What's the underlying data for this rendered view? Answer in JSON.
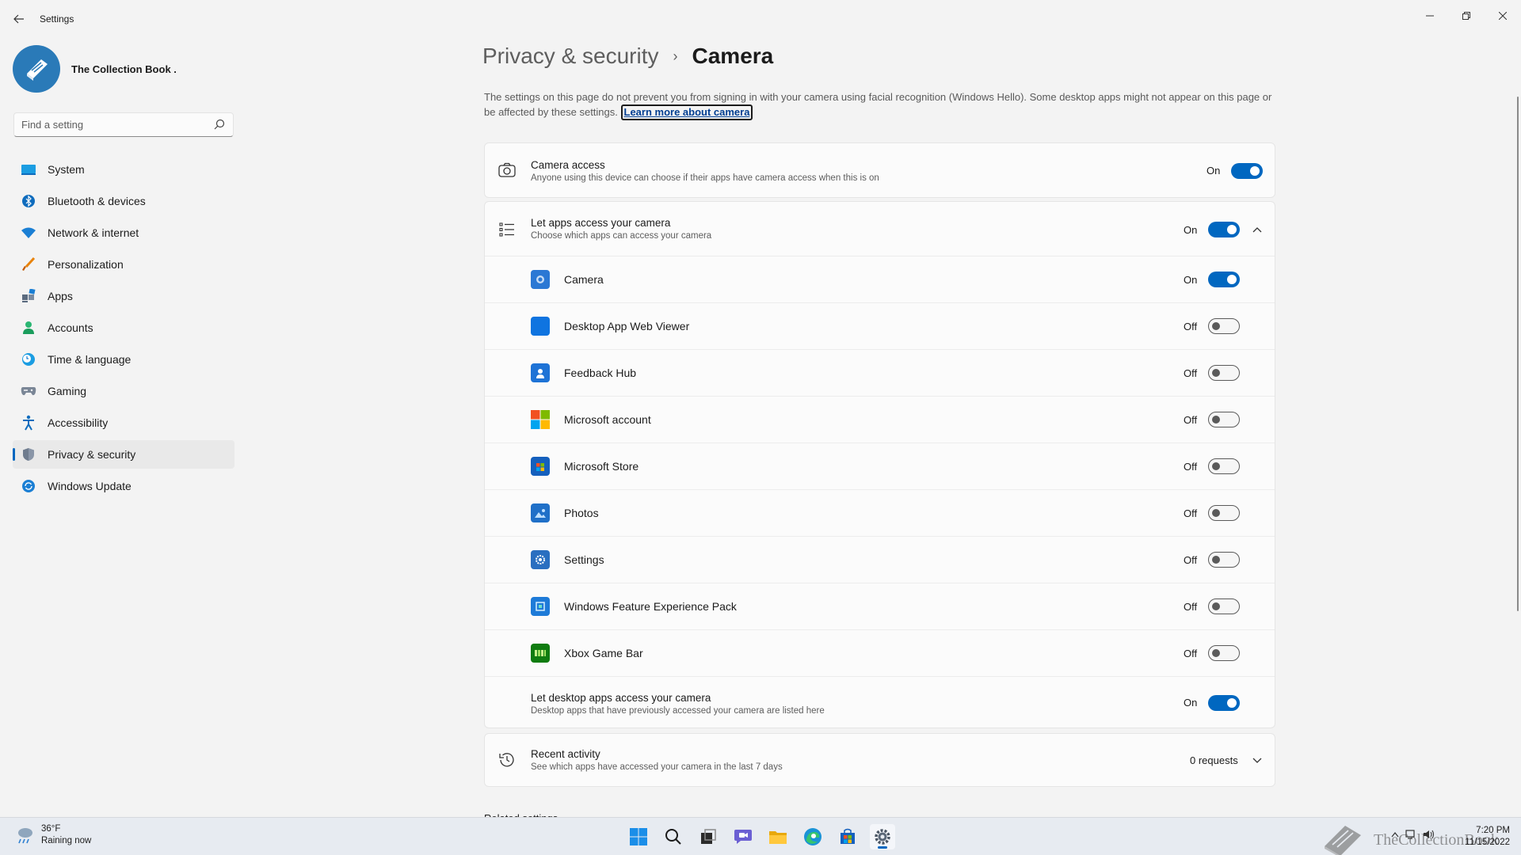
{
  "window": {
    "title": "Settings",
    "controls": [
      "minimize",
      "restore",
      "close"
    ]
  },
  "profile": {
    "name": "The Collection Book ."
  },
  "search": {
    "placeholder": "Find a setting"
  },
  "sidebar": {
    "items": [
      {
        "label": "System",
        "icon": "system-icon"
      },
      {
        "label": "Bluetooth & devices",
        "icon": "bluetooth-icon"
      },
      {
        "label": "Network & internet",
        "icon": "wifi-icon"
      },
      {
        "label": "Personalization",
        "icon": "brush-icon"
      },
      {
        "label": "Apps",
        "icon": "apps-icon"
      },
      {
        "label": "Accounts",
        "icon": "accounts-icon"
      },
      {
        "label": "Time & language",
        "icon": "clock-globe-icon"
      },
      {
        "label": "Gaming",
        "icon": "gamepad-icon"
      },
      {
        "label": "Accessibility",
        "icon": "accessibility-icon"
      },
      {
        "label": "Privacy & security",
        "icon": "shield-icon",
        "active": true
      },
      {
        "label": "Windows Update",
        "icon": "update-icon"
      }
    ]
  },
  "breadcrumb": {
    "parent": "Privacy & security",
    "separator": "›",
    "current": "Camera"
  },
  "description": {
    "text": "The settings on this page do not prevent you from signing in with your camera using facial recognition (Windows Hello). Some desktop apps might not appear on this page or be affected by these settings.",
    "link": "Learn more about camera"
  },
  "camera_access": {
    "title": "Camera access",
    "subtitle": "Anyone using this device can choose if their apps have camera access when this is on",
    "state": "On"
  },
  "let_apps": {
    "title": "Let apps access your camera",
    "subtitle": "Choose which apps can access your camera",
    "state": "On",
    "apps": [
      {
        "name": "Camera",
        "state": "On",
        "icon": "camera-app-icon",
        "color": "#2b78d4"
      },
      {
        "name": "Desktop App Web Viewer",
        "state": "Off",
        "icon": "web-viewer-icon",
        "color": "#0f74e0"
      },
      {
        "name": "Feedback Hub",
        "state": "Off",
        "icon": "feedback-hub-icon",
        "color": "#1e73d6"
      },
      {
        "name": "Microsoft account",
        "state": "Off",
        "icon": "microsoft-logo-icon",
        "color": "#f25022"
      },
      {
        "name": "Microsoft Store",
        "state": "Off",
        "icon": "store-icon",
        "color": "#1560bd"
      },
      {
        "name": "Photos",
        "state": "Off",
        "icon": "photos-icon",
        "color": "#2070c8"
      },
      {
        "name": "Settings",
        "state": "Off",
        "icon": "settings-app-icon",
        "color": "#2a6fc0"
      },
      {
        "name": "Windows Feature Experience Pack",
        "state": "Off",
        "icon": "feature-pack-icon",
        "color": "#1e7bd8"
      },
      {
        "name": "Xbox Game Bar",
        "state": "Off",
        "icon": "xbox-game-bar-icon",
        "color": "#107c10"
      }
    ]
  },
  "desktop_apps": {
    "title": "Let desktop apps access your camera",
    "subtitle": "Desktop apps that have previously accessed your camera are listed here",
    "state": "On"
  },
  "recent_activity": {
    "title": "Recent activity",
    "subtitle": "See which apps have accessed your camera in the last 7 days",
    "count": "0 requests"
  },
  "cut_off_heading": "Related settings",
  "taskbar": {
    "weather": {
      "temp": "36°F",
      "condition": "Raining now"
    },
    "apps": [
      "start-icon",
      "search-icon",
      "task-view-icon",
      "chat-icon",
      "file-explorer-icon",
      "edge-icon",
      "store-icon",
      "settings-icon"
    ],
    "watermark": "TheCollectionBook",
    "time": "7:20 PM",
    "date": "11/15/2022"
  }
}
